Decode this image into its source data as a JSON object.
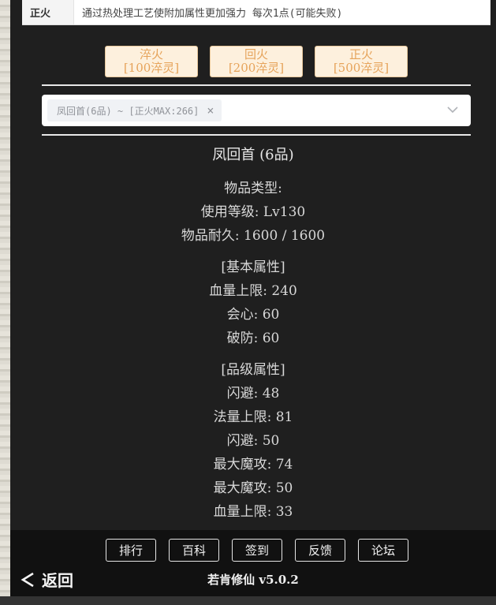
{
  "info": {
    "label": "正火",
    "desc": "通过热处理工艺使附加属性更加强力 每次1点(可能失败)"
  },
  "actions": [
    {
      "line1": "淬火",
      "line2": "[100淬灵]"
    },
    {
      "line1": "回火",
      "line2": "[200淬灵]"
    },
    {
      "line1": "正火",
      "line2": "[500淬灵]"
    }
  ],
  "select": {
    "tag": "凤回首(6品) ~ [正火MAX:266]",
    "close": "×"
  },
  "item": {
    "name": "凤回首 (6品)",
    "type": "物品类型:",
    "level": "使用等级: Lv130",
    "durability": "物品耐久: 1600 / 1600",
    "basic_title": "[基本属性]",
    "basic": [
      "血量上限: 240",
      "会心: 60",
      "破防: 60"
    ],
    "grade_title": "[品级属性]",
    "grade": [
      "闪避: 48",
      "法量上限: 81",
      "闪避: 50",
      "最大魔攻: 74",
      "最大魔攻: 50",
      "血量上限: 33"
    ]
  },
  "footer": {
    "nav": [
      "排行",
      "百科",
      "签到",
      "反馈",
      "论坛"
    ],
    "back": "返回",
    "version": "若肯修仙 v5.0.2"
  }
}
